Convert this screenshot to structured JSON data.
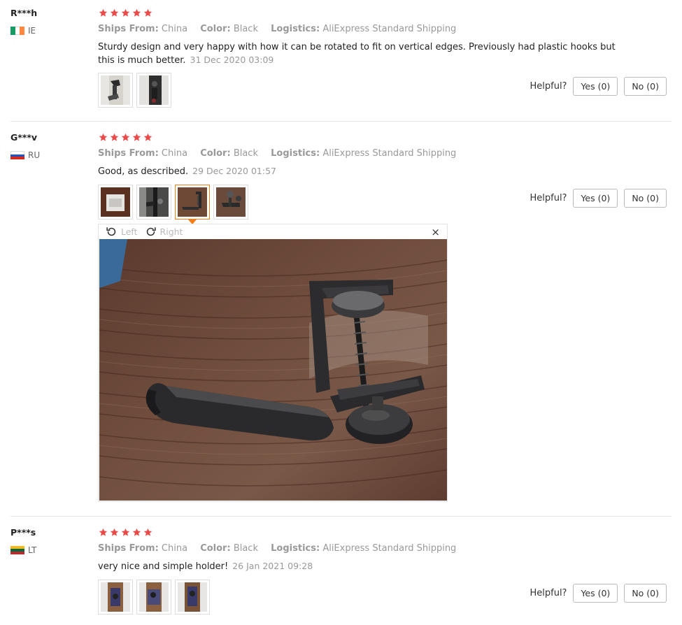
{
  "labels": {
    "ships_from": "Ships From:",
    "color": "Color:",
    "logistics": "Logistics:",
    "helpful": "Helpful?",
    "yes": "Yes (0)",
    "no": "No (0)",
    "rotate_left": "Left",
    "rotate_right": "Right",
    "close": "×"
  },
  "colors": {
    "star": "#e94a4a",
    "thumb_selected": "#f57f17"
  },
  "reviews": [
    {
      "user": "R***h",
      "country": "IE",
      "rating": 5,
      "ships_from": "China",
      "color": "Black",
      "logistics": "AliExpress Standard Shipping",
      "text": "Sturdy design and very happy with how it can be rotated to fit on vertical edges. Previously had plastic hooks but this is much better.",
      "date": "31 Dec 2020 03:09"
    },
    {
      "user": "G***v",
      "country": "RU",
      "rating": 5,
      "ships_from": "China",
      "color": "Black",
      "logistics": "AliExpress Standard Shipping",
      "text": "Good, as described.",
      "date": "29 Dec 2020 01:57"
    },
    {
      "user": "P***s",
      "country": "LT",
      "rating": 5,
      "ships_from": "China",
      "color": "Black",
      "logistics": "AliExpress Standard Shipping",
      "text": "very nice and simple holder!",
      "date": "26 Jan 2021 09:28"
    }
  ]
}
